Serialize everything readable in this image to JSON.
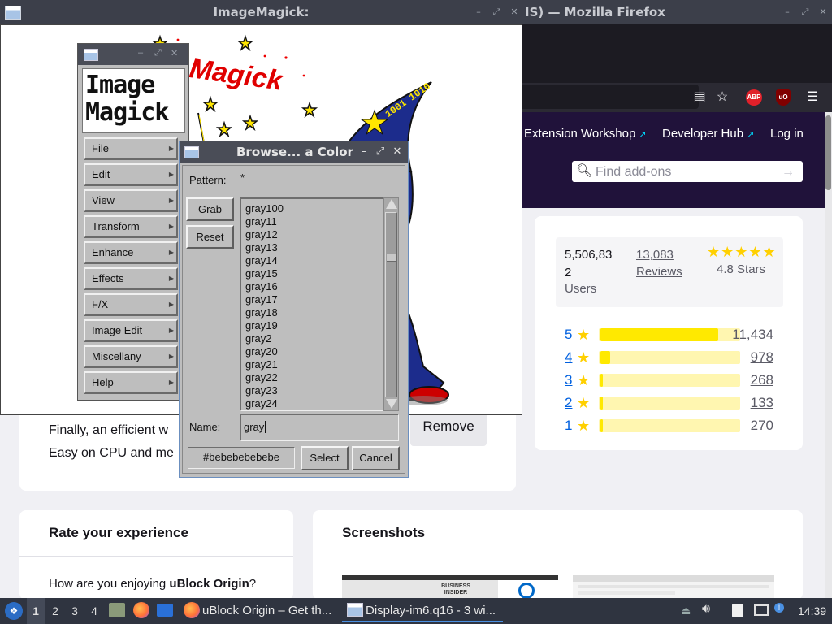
{
  "firefox": {
    "title": "ImageMagick:",
    "title_right": "IS) — Mozilla Firefox",
    "toolbar": {
      "reader_icon": "reader-view-icon",
      "bookmark_icon": "star-icon",
      "abp_label": "ABP",
      "ubo_label": "uO",
      "menu_icon": "hamburger-icon"
    }
  },
  "amo": {
    "nav": [
      "Extension Workshop",
      "Developer Hub",
      "Log in"
    ],
    "search_placeholder": "Find add-ons",
    "stats": {
      "users_value": "5,506,83",
      "users_value_wrap": "2",
      "users_label": "Users",
      "reviews_value": "13,083",
      "reviews_label": "Reviews",
      "stars_label": "4.8 Stars",
      "rating": 4.8
    },
    "rating_bars": [
      {
        "stars": "5",
        "count": "11,434",
        "fraction": 0.85
      },
      {
        "stars": "4",
        "count": "978",
        "fraction": 0.07
      },
      {
        "stars": "3",
        "count": "268",
        "fraction": 0.02
      },
      {
        "stars": "2",
        "count": "133",
        "fraction": 0.01
      },
      {
        "stars": "1",
        "count": "270",
        "fraction": 0.02
      }
    ],
    "description_line1": "Finally, an efficient w",
    "description_line2": "Easy on CPU and me",
    "remove_label": "Remove",
    "rate_title": "Rate your experience",
    "rate_question_prefix": "How are you enjoying ",
    "rate_question_name": "uBlock Origin",
    "rate_question_suffix": "?",
    "screenshots_title": "Screenshots",
    "shot1_text": "BUSINESS INSIDER"
  },
  "imagemagick": {
    "logo_line1": "Image",
    "logo_line2": "Magick",
    "art_text": "Magick",
    "art_binary": "1001 1010",
    "menu": [
      "File",
      "Edit",
      "View",
      "Transform",
      "Enhance",
      "Effects",
      "F/X",
      "Image Edit",
      "Miscellany",
      "Help"
    ]
  },
  "browse_dialog": {
    "title": "Browse... a Color",
    "pattern_label": "Pattern:",
    "pattern_value": "*",
    "grab_label": "Grab",
    "reset_label": "Reset",
    "colors": [
      "gray100",
      "gray11",
      "gray12",
      "gray13",
      "gray14",
      "gray15",
      "gray16",
      "gray17",
      "gray18",
      "gray19",
      "gray2",
      "gray20",
      "gray21",
      "gray22",
      "gray23",
      "gray24"
    ],
    "name_label": "Name:",
    "name_value": "gray",
    "color_value": "#bebebebebebe",
    "select_label": "Select",
    "cancel_label": "Cancel"
  },
  "taskbar": {
    "workspaces": [
      "1",
      "2",
      "3",
      "4"
    ],
    "task1": "uBlock Origin – Get th...",
    "task2": "Display-im6.q16 - 3 wi...",
    "clock": "14:39"
  }
}
